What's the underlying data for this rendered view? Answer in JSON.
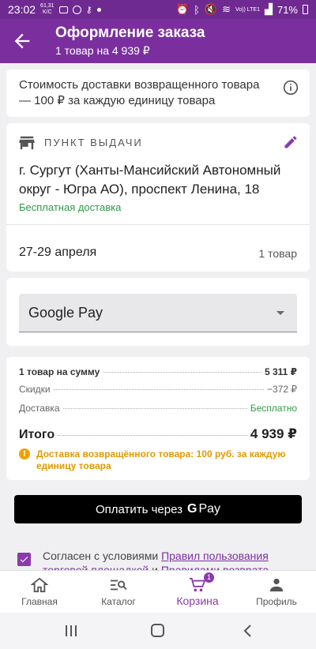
{
  "status_bar": {
    "time": "23:02",
    "speed_value": "61,31",
    "speed_unit": "K/C",
    "network": "Vo)) LTE1",
    "battery": "71%"
  },
  "app_bar": {
    "title": "Оформление заказа",
    "subtitle": "1 товар на 4 939 ₽"
  },
  "notice": {
    "text": "Стоимость доставки возвращенного товара — 100 ₽ за каждую единицу товара"
  },
  "pickup": {
    "label": "ПУНКТ ВЫДАЧИ",
    "address": "г. Сургут (Ханты-Мансийский Автономный округ - Югра АО), проспект Ленина, 18",
    "delivery_note": "Бесплатная доставка",
    "dates": "27-29 апреля",
    "items_count": "1 товар"
  },
  "payment": {
    "selected": "Google Pay"
  },
  "summary": {
    "items_label": "1 товар на сумму",
    "items_value": "5 311 ₽",
    "discount_label": "Скидки",
    "discount_value": "−372 ₽",
    "delivery_label": "Доставка",
    "delivery_value": "Бесплатно",
    "total_label": "Итого",
    "total_value": "4 939 ₽",
    "warning": "Доставка возвращённого товара: 100 руб. за каждую единицу товара"
  },
  "pay_button": {
    "label": "Оплатить через",
    "g": "G",
    "pay": "Pay"
  },
  "agreement": {
    "prefix": "Согласен с условиями ",
    "link1": "Правил пользования торговой площадкой",
    "middle": " и ",
    "link2": "Правилами возврата"
  },
  "bottom_nav": {
    "home": "Главная",
    "catalog": "Каталог",
    "cart": "Корзина",
    "cart_badge": "1",
    "profile": "Профиль"
  },
  "colors": {
    "primary": "#7b2f9f",
    "success": "#2e9b48",
    "warning": "#e09a00"
  }
}
